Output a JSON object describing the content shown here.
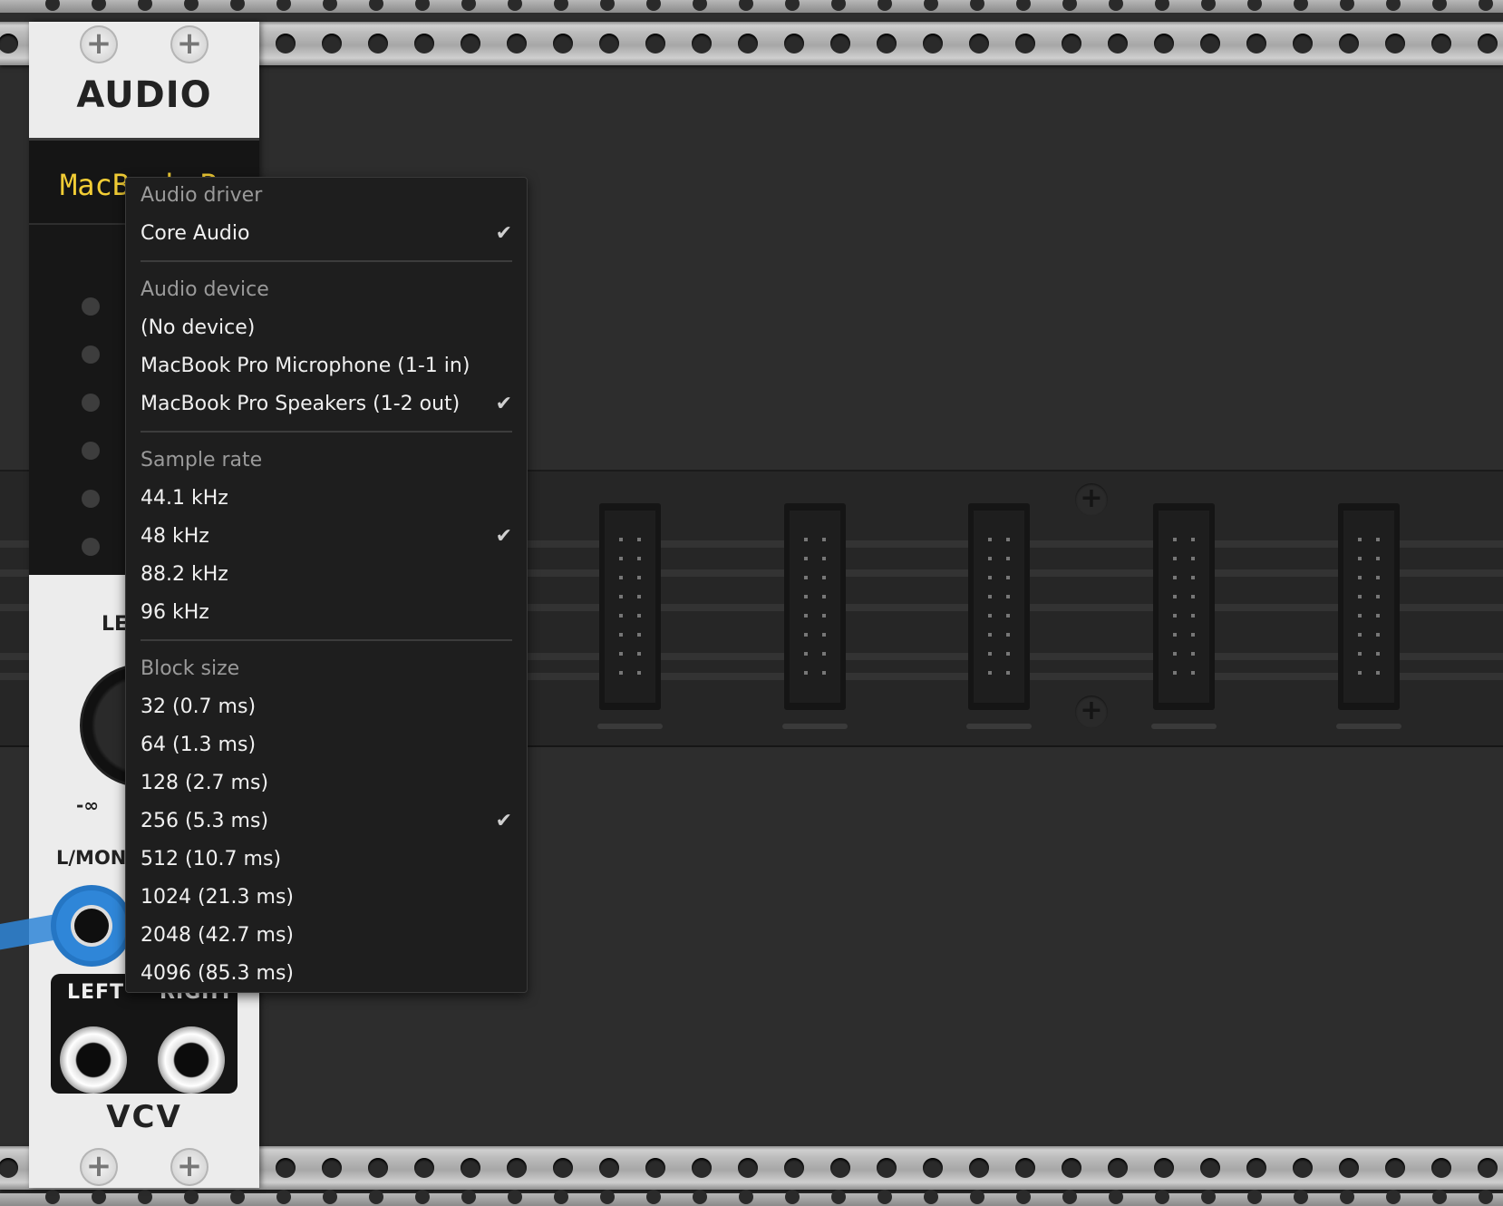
{
  "module": {
    "title": "AUDIO",
    "display_text": "MacBook Pro",
    "level_label": "LEVEL",
    "neg_inf_label": "-∞",
    "input_label": "L/MONO",
    "outputs": {
      "left": "LEFT",
      "right": "RIGHT"
    },
    "brand": "VCV"
  },
  "menu": {
    "driver_header": "Audio driver",
    "driver_items": [
      {
        "label": "Core Audio",
        "check": "✔"
      }
    ],
    "device_header": "Audio device",
    "device_items": [
      {
        "label": "(No device)",
        "check": ""
      },
      {
        "label": "MacBook Pro Microphone (1-1 in)",
        "check": ""
      },
      {
        "label": "MacBook Pro Speakers (1-2 out)",
        "check": "✔"
      }
    ],
    "rate_header": "Sample rate",
    "rate_items": [
      {
        "label": "44.1 kHz",
        "check": ""
      },
      {
        "label": "48 kHz",
        "check": "✔"
      },
      {
        "label": "88.2 kHz",
        "check": ""
      },
      {
        "label": "96 kHz",
        "check": ""
      }
    ],
    "block_header": "Block size",
    "block_items": [
      {
        "label": "32 (0.7 ms)",
        "check": ""
      },
      {
        "label": "64 (1.3 ms)",
        "check": ""
      },
      {
        "label": "128 (2.7 ms)",
        "check": ""
      },
      {
        "label": "256 (5.3 ms)",
        "check": "✔"
      },
      {
        "label": "512 (10.7 ms)",
        "check": ""
      },
      {
        "label": "1024 (21.3 ms)",
        "check": ""
      },
      {
        "label": "2048 (42.7 ms)",
        "check": ""
      },
      {
        "label": "4096 (85.3 ms)",
        "check": ""
      }
    ]
  },
  "icons": {
    "screw": "screw-icon",
    "check": "checkmark-icon"
  }
}
